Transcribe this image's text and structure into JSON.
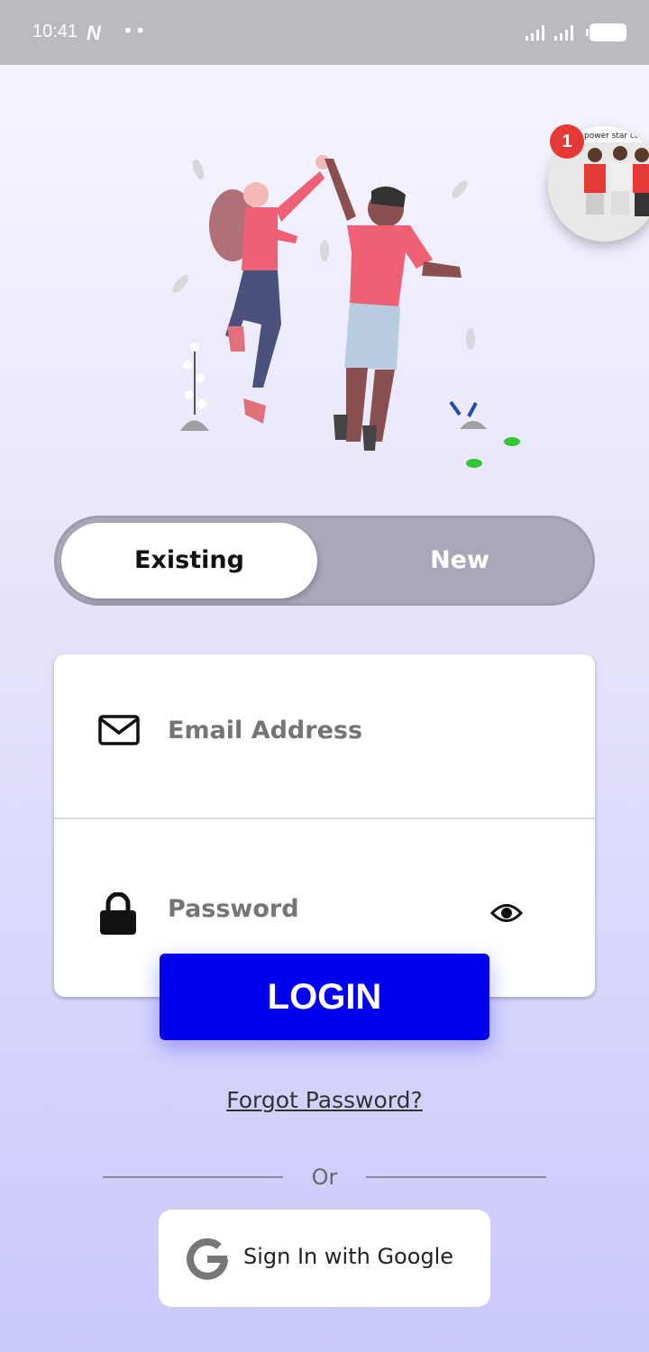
{
  "status_bar": {
    "time": "10:41",
    "notification_glyph": "N",
    "dots": "••"
  },
  "chat_head": {
    "badge_count": "1",
    "caption": "power star comedy"
  },
  "toggle": {
    "existing_label": "Existing",
    "new_label": "New"
  },
  "form": {
    "email_placeholder": "Email Address",
    "password_placeholder": "Password"
  },
  "login_label": "LOGIN",
  "forgot_label": "Forgot Password?",
  "or_label": "Or",
  "google": {
    "label": "Sign In with Google",
    "icon": "google-g-icon"
  },
  "colors": {
    "login_button": "#0000ee",
    "toggle_track": "#a9a8b9",
    "badge": "#e53935"
  }
}
